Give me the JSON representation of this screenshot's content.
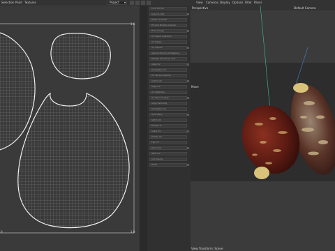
{
  "menubar": {
    "left_items": [
      "Selection",
      "Paint",
      "Textures"
    ],
    "dropdown_value": "Project",
    "right_items": [
      "View",
      "Cameras",
      "Display",
      "Options",
      "Filter",
      "Panel"
    ]
  },
  "uv_view": {
    "top_right_label": "1.0",
    "bottom_right_label": "1.0",
    "bottom_left_label": "0"
  },
  "tool_panel": {
    "items": [
      "Lock UV Pts",
      "Snap to UVs",
      "Relax UV Mesh",
      "Fit Grid Position Islands",
      "Fit to Image",
      "UV Island Selection",
      "UV Edges",
      "UV Islands",
      "Islands Packing & Mapping",
      "Realign Islands by Axis",
      "Align UV",
      "Straighten UV",
      "UV Terrace Islands",
      "Unfold UV",
      "Align UV",
      "UV Optimize",
      "UV Move & Align",
      "Align Vertically",
      "Straighten UV",
      "Symmetry",
      "Stitch UV",
      "Merge UV",
      "Scale UV",
      "Rotate UV",
      "Flip UV",
      "Mirror UV",
      "Weld UV",
      "Cut Seams",
      "Relax"
    ]
  },
  "viewport": {
    "title": "Perspective",
    "camera": "Default Camera",
    "move_label": "Move",
    "footer": "View Transform: Scene",
    "colors": {
      "seed_dark": "#5a1a12",
      "seed_mid": "#7a2a1a",
      "seed_spot": "#c9a76a",
      "seed_grey": "#8a7a66",
      "tip": "#d9c27a"
    }
  }
}
